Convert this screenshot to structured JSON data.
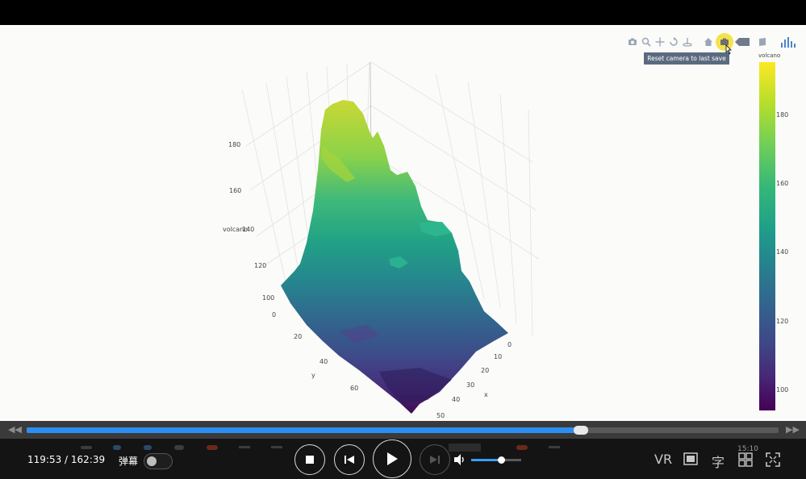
{
  "plot": {
    "modebar_tooltip": "Reset camera to last save",
    "modebar_icons": [
      "camera-icon",
      "zoom-icon",
      "pan-icon",
      "orbit-rotation-icon",
      "turntable-rotation-icon",
      "home-icon",
      "reset-camera-last-save-icon",
      "hover-closest-icon",
      "toggle-spike-lines-icon",
      "plotly-logo-icon"
    ],
    "colorbar_title": "volcano",
    "colorbar_ticks": [
      "180",
      "160",
      "140",
      "120",
      "100"
    ],
    "z_axis_title": "volcano",
    "z_ticks": [
      "180",
      "160",
      "140",
      "120",
      "100"
    ],
    "y_axis_title": "y",
    "y_ticks": [
      "0",
      "20",
      "40",
      "60"
    ],
    "x_axis_title": "x",
    "x_ticks": [
      "0",
      "10",
      "20",
      "30",
      "40",
      "50"
    ],
    "colorscale": [
      "#440154",
      "#482878",
      "#3e4989",
      "#31688e",
      "#26828e",
      "#1f9e89",
      "#35b779",
      "#6ece58",
      "#b5de2b",
      "#fde725"
    ]
  },
  "player": {
    "time_display": "119:53 / 162:39",
    "progress_fraction": 0.737,
    "danmu_label": "弹幕",
    "volume_fraction": 0.6,
    "vr_label": "VR",
    "subtitle_label": "字",
    "clock": "15:10",
    "seek_back_glyph": "◀◀",
    "seek_fwd_glyph": "▶▶"
  }
}
